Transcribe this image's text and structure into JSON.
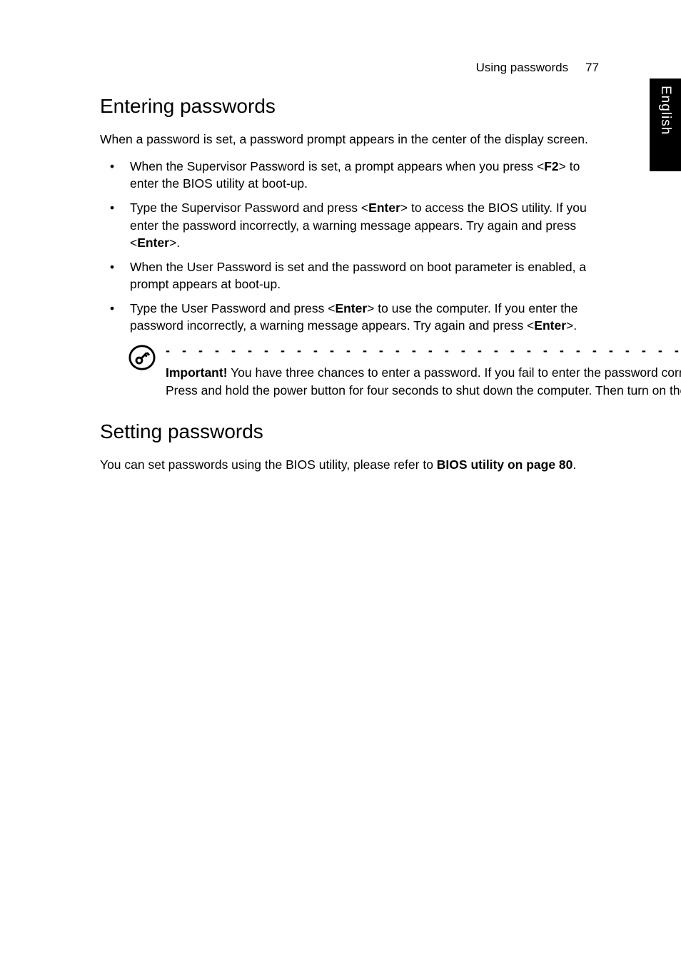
{
  "header": {
    "title": "Using passwords",
    "page_number": "77"
  },
  "side_tab": "English",
  "section1": {
    "heading": "Entering passwords",
    "intro": "When a password is set, a password prompt appears in the center of the display screen.",
    "bullets": {
      "b1a": "When the Supervisor Password is set, a prompt appears when you press <",
      "b1b": "F2",
      "b1c": "> to enter the BIOS utility at boot-up.",
      "b2a": "Type the Supervisor Password and press <",
      "b2b": "Enter",
      "b2c": "> to access the BIOS utility. If you enter the password incorrectly, a warning message appears. Try again and press <",
      "b2d": "Enter",
      "b2e": ">.",
      "b3": "When the User Password is set and the password on boot parameter is enabled, a prompt appears at boot-up.",
      "b4a": "Type the User Password and press <",
      "b4b": "Enter",
      "b4c": "> to use the computer. If you enter the password incorrectly, a warning message appears. Try again and press <",
      "b4d": "Enter",
      "b4e": ">."
    },
    "note": {
      "label": "Important!",
      "text": " You have three chances to enter a password. If you fail to enter the password correctly after three tries, the system halts. Press and hold the power button for four seconds to shut down the computer. Then turn on the computer again, and try again."
    }
  },
  "section2": {
    "heading": "Setting passwords",
    "body_a": "You can set passwords using the BIOS utility, please refer to ",
    "body_b": "BIOS utility on page 80",
    "body_c": "."
  },
  "dots": "- - - - - - - - - - - - - - - - - - - - - - - - - - - - - - - - - - - - - - - - - - - - - -"
}
